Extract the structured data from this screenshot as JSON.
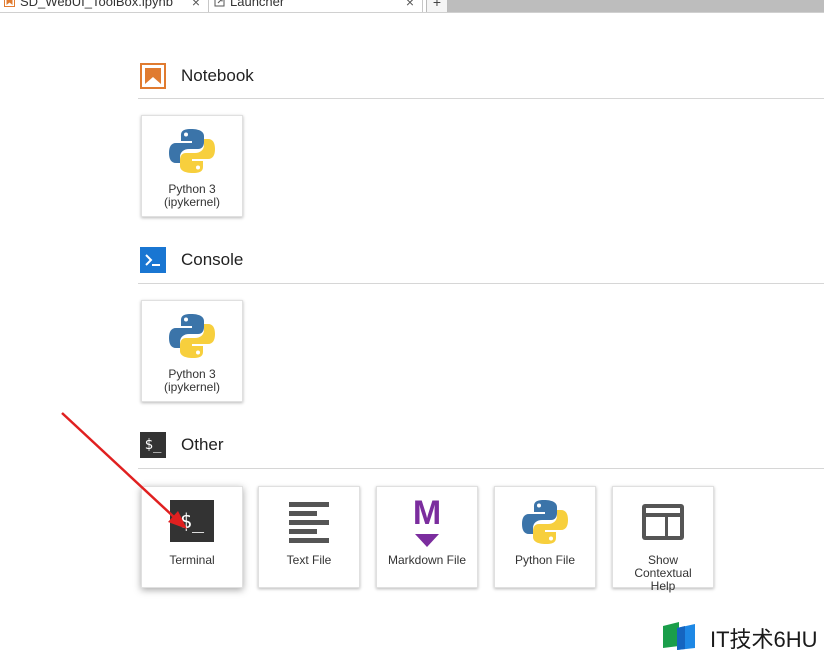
{
  "tabs": [
    {
      "label": "SD_WebUI_ToolBox.ipynb",
      "close": "×",
      "icon": "notebook-icon"
    },
    {
      "label": "Launcher",
      "close": "×",
      "icon": "launcher-icon"
    }
  ],
  "new_tab_label": "+",
  "sections": {
    "notebook": {
      "title": "Notebook",
      "cards": [
        {
          "label": "Python 3\n(ipykernel)",
          "icon": "python-logo-icon"
        }
      ]
    },
    "console": {
      "title": "Console",
      "cards": [
        {
          "label": "Python 3\n(ipykernel)",
          "icon": "python-logo-icon"
        }
      ]
    },
    "other": {
      "title": "Other",
      "icon_text": "$_",
      "cards": [
        {
          "label": "Terminal",
          "icon": "terminal-icon",
          "icon_text": "$_"
        },
        {
          "label": "Text File",
          "icon": "text-file-icon"
        },
        {
          "label": "Markdown File",
          "icon": "markdown-icon",
          "icon_text": "M"
        },
        {
          "label": "Python File",
          "icon": "python-logo-icon"
        },
        {
          "label": "Show\nContextual\nHelp",
          "icon": "contextual-help-icon"
        }
      ]
    }
  },
  "watermark": {
    "text": "IT技术6HU"
  },
  "colors": {
    "notebook_accent": "#e07b30",
    "console_accent": "#1976d2",
    "terminal_bg": "#333333",
    "markdown_accent": "#7b2d9e",
    "python_blue": "#3b74a9",
    "python_yellow": "#f7cf3d",
    "annotation_arrow": "#e02020"
  }
}
